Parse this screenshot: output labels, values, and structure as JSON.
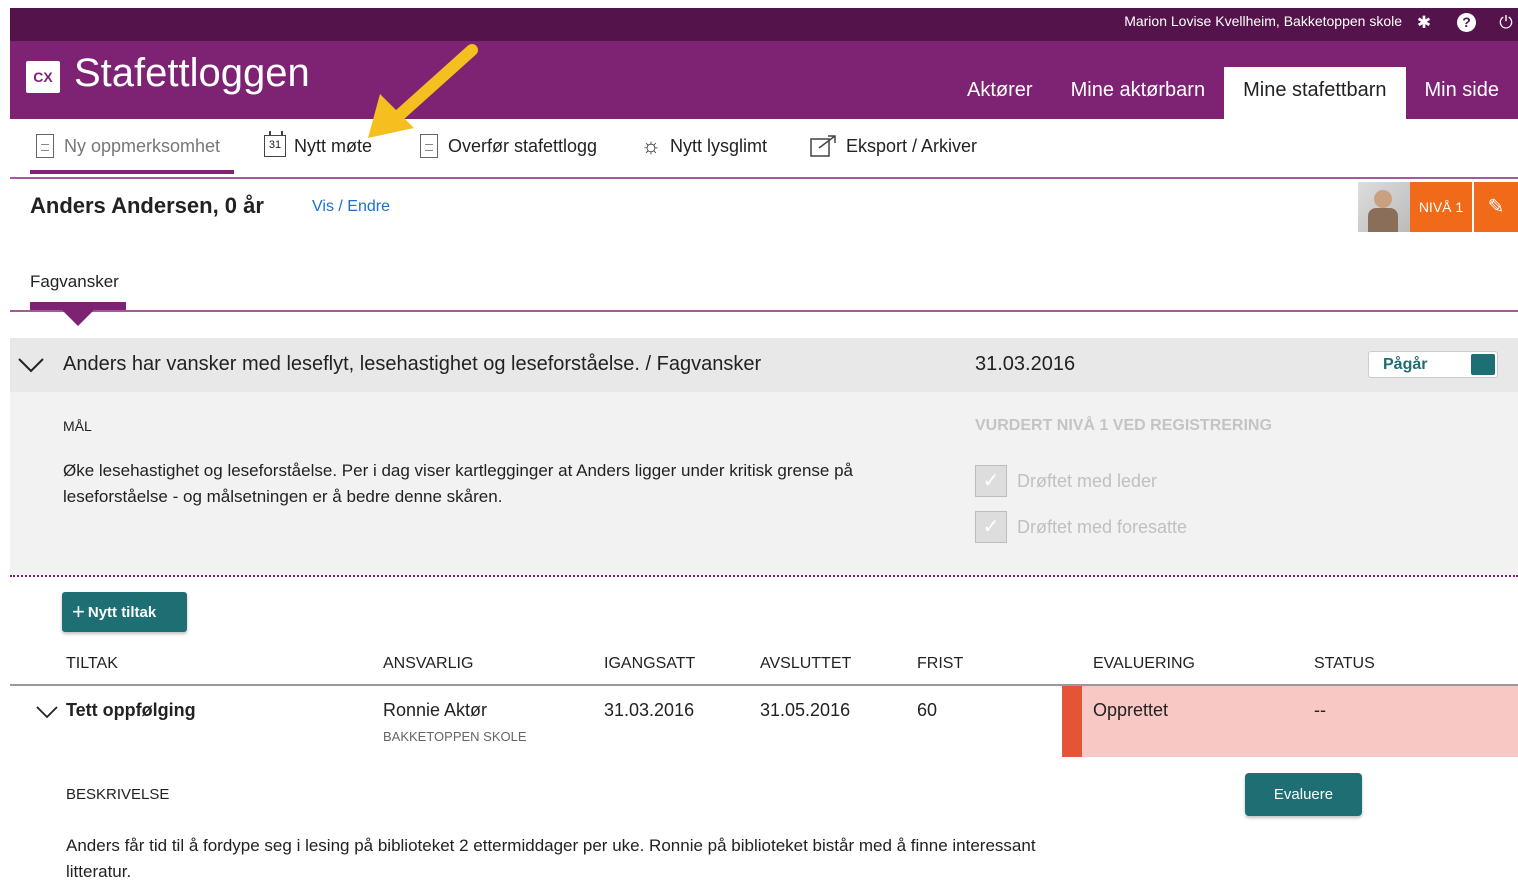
{
  "topbar": {
    "user": "Marion Lovise Kvellheim, Bakketoppen skole",
    "icons": [
      "gear-icon",
      "help-icon",
      "power-icon"
    ]
  },
  "header": {
    "logo": "CX",
    "title": "Stafettloggen",
    "tabs": [
      {
        "label": "Aktører",
        "active": false
      },
      {
        "label": "Mine aktørbarn",
        "active": false
      },
      {
        "label": "Mine stafettbarn",
        "active": true
      },
      {
        "label": "Min side",
        "active": false
      }
    ]
  },
  "toolbar": {
    "items": [
      {
        "label": "Ny oppmerksomhet",
        "icon": "document-icon",
        "disabled": true
      },
      {
        "label": "Nytt møte",
        "icon": "calendar-icon",
        "icon_text": "31"
      },
      {
        "label": "Overfør stafettlogg",
        "icon": "document-icon"
      },
      {
        "label": "Nytt lysglimt",
        "icon": "sun-icon"
      },
      {
        "label": "Eksport / Arkiver",
        "icon": "export-icon"
      }
    ]
  },
  "person": {
    "name": "Anders Andersen, 0 år",
    "link": "Vis / Endre",
    "level": "NIVÅ 1"
  },
  "subtab": {
    "label": "Fagvansker"
  },
  "issue": {
    "title": "Anders har vansker med leseflyt, lesehastighet og leseforståelse. / Fagvansker",
    "date": "31.03.2016",
    "status": "Pågår"
  },
  "goal": {
    "label": "MÅL",
    "text": "Øke lesehastighet og leseforståelse. Per i dag viser kartlegginger at Anders ligger under kritisk grense på leseforståelse - og målsetningen er å bedre denne skåren.",
    "assessment_label": "VURDERT NIVÅ 1 VED REGISTRERING",
    "checks": [
      {
        "label": "Drøftet med leder",
        "checked": true
      },
      {
        "label": "Drøftet med foresatte",
        "checked": true
      }
    ]
  },
  "measures": {
    "add_label": "Nytt tiltak",
    "columns": [
      "TILTAK",
      "ANSVARLIG",
      "IGANGSATT",
      "AVSLUTTET",
      "FRIST",
      "EVALUERING",
      "STATUS"
    ],
    "row": {
      "tiltak": "Tett oppfølging",
      "ansvarlig": "Ronnie Aktør",
      "ansvarlig_sub": "BAKKETOPPEN SKOLE",
      "igangsatt": "31.03.2016",
      "avsluttet": "31.05.2016",
      "frist": "60",
      "evaluering": "Opprettet",
      "status": "--"
    },
    "evaluate_label": "Evaluere",
    "description_label": "BESKRIVELSE",
    "description": "Anders får tid til å fordype seg i lesing på biblioteket 2 ettermiddager per uke. Ronnie på biblioteket bistår med å finne interessant litteratur."
  },
  "colors": {
    "header": "#7e2274",
    "topbar": "#55134b",
    "teal": "#1e6f73",
    "orange": "#f06a1a",
    "eval_bg": "#f8c8c4",
    "eval_bar": "#e45436",
    "annotation_arrow": "#f5c01f"
  }
}
